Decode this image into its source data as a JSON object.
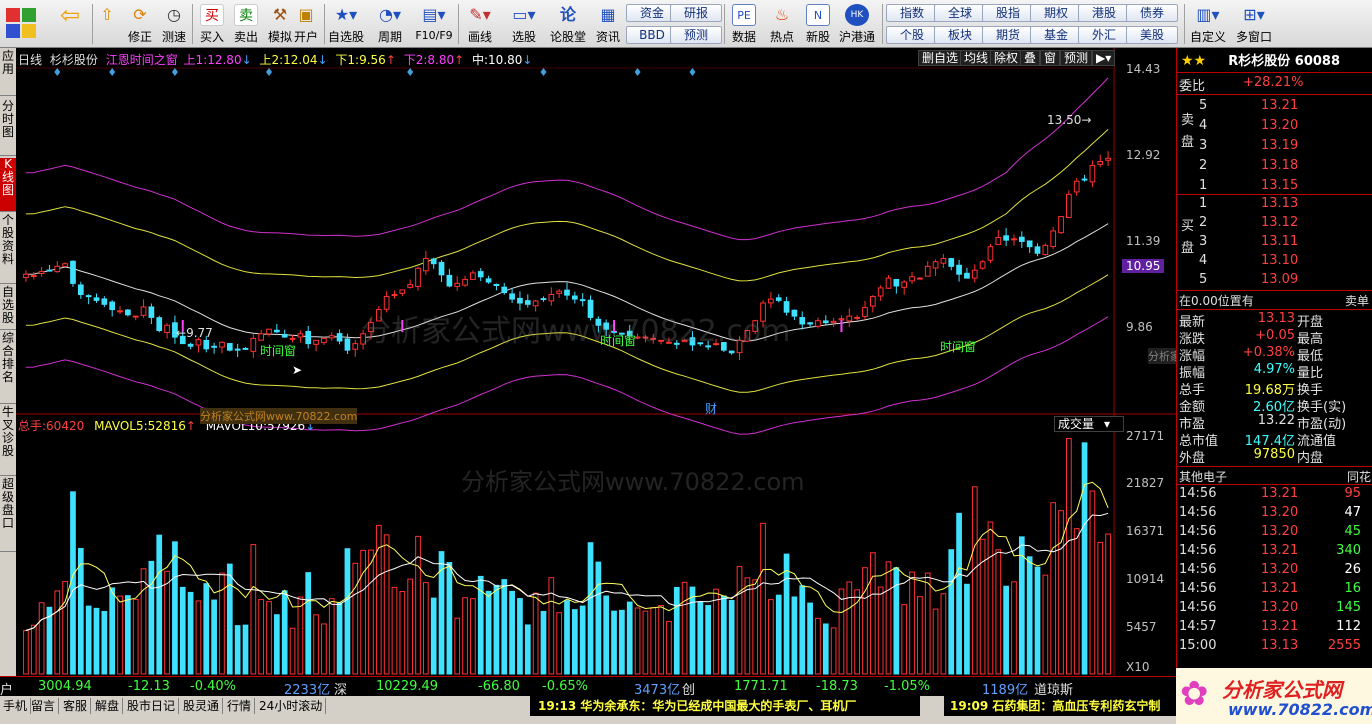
{
  "toolbar": {
    "buttons": [
      {
        "name": "back",
        "label": ""
      },
      {
        "name": "up",
        "label": ""
      },
      {
        "name": "fix",
        "label": "修正"
      },
      {
        "name": "measure",
        "label": "测速"
      },
      {
        "name": "buy",
        "label": "买入"
      },
      {
        "name": "sell",
        "label": "卖出"
      },
      {
        "name": "sim",
        "label": "模拟"
      },
      {
        "name": "open",
        "label": "开户"
      },
      {
        "name": "selfsel",
        "label": "自选股"
      },
      {
        "name": "period",
        "label": "周期"
      },
      {
        "name": "f10",
        "label": "F10/F9"
      },
      {
        "name": "draw",
        "label": "画线"
      },
      {
        "name": "pick",
        "label": "选股"
      },
      {
        "name": "forum",
        "label": "论股堂"
      },
      {
        "name": "info",
        "label": "资讯"
      },
      {
        "name": "data",
        "label": "数据"
      },
      {
        "name": "hot",
        "label": "热点"
      },
      {
        "name": "newstock",
        "label": "新股"
      },
      {
        "name": "hk",
        "label": "沪港通"
      },
      {
        "name": "custom",
        "label": "自定义"
      },
      {
        "name": "multiwin",
        "label": "多窗口"
      }
    ],
    "buy_char": "买",
    "sell_char": "卖",
    "small_buttons": [
      "资金",
      "研报",
      "BBD",
      "预测",
      "指数",
      "全球",
      "股指",
      "期权",
      "港股",
      "债券",
      "个股",
      "板块",
      "期货",
      "基金",
      "外汇",
      "美股"
    ]
  },
  "side_tabs": [
    "应用",
    "分时图",
    "K线图",
    "个股资料",
    "自选股",
    "综合排名",
    "牛叉诊股",
    "超级盘口"
  ],
  "chart_header": {
    "period": "日线",
    "stock": "杉杉股份",
    "indicator": "江恩时间之窗",
    "up1_label": "上1:",
    "up1": "12.80",
    "up2_label": "上2:",
    "up2": "12.04",
    "dn1_label": "下1:",
    "dn1": "9.56",
    "dn2_label": "下2:",
    "dn2": "8.80",
    "mid_label": "中:",
    "mid": "10.80"
  },
  "chart_controls": [
    "删自选",
    "均线",
    "除权",
    "叠",
    "窗",
    "预测"
  ],
  "price_axis": [
    "14.43",
    "12.92",
    "11.39",
    "10.95",
    "9.86"
  ],
  "volume_axis": [
    "27171",
    "21827",
    "16371",
    "10914",
    "5457",
    "X10"
  ],
  "annotations": {
    "high": "13.50",
    "low": "9.77",
    "time_window": "时间窗",
    "cai": "财",
    "watermark": "分析家公式网www.70822.com",
    "watermark_short": "分析家公式网www.70822.com"
  },
  "volume_header": {
    "total_label": "总手:",
    "total": "60420",
    "ma5_label": "MAVOL5:",
    "ma5": "52816",
    "ma10_label": "MAVOL10:",
    "ma10": "57926",
    "selector": "成交量"
  },
  "chart_data": {
    "type": "candlestick",
    "price_range": [
      9.5,
      14.6
    ],
    "volume_range": [
      0,
      28500
    ],
    "closes": [
      11.36,
      11.34,
      11.4,
      11.42,
      11.48,
      11.52,
      11.22,
      11.05,
      11.02,
      10.96,
      10.9,
      10.82,
      10.8,
      10.74,
      10.72,
      10.86,
      10.7,
      10.5,
      10.58,
      10.4,
      10.3,
      10.26,
      10.36,
      10.22,
      10.25,
      10.32,
      10.2,
      10.2,
      10.22,
      10.38,
      10.45,
      10.52,
      10.48,
      10.4,
      10.38,
      10.45,
      10.3,
      10.35,
      10.38,
      10.42,
      10.34,
      10.2,
      10.3,
      10.45,
      10.62,
      10.82,
      11.02,
      11.05,
      11.12,
      11.2,
      11.45,
      11.6,
      11.52,
      11.35,
      11.18,
      11.22,
      11.28,
      11.38,
      11.32,
      11.24,
      11.2,
      11.08,
      10.98,
      10.92,
      10.9,
      10.95,
      10.98,
      11.05,
      11.1,
      11.04,
      10.98,
      10.96,
      10.7,
      10.58,
      10.52,
      10.48,
      10.45,
      10.42,
      10.4,
      10.4,
      10.38,
      10.35,
      10.32,
      10.3,
      10.35,
      10.28,
      10.3,
      10.25,
      10.3,
      10.2,
      10.16,
      10.35,
      10.5,
      10.65,
      10.92,
      10.98,
      10.96,
      10.78,
      10.72,
      10.6,
      10.6,
      10.65,
      10.62,
      10.64,
      10.68,
      10.72,
      10.7,
      10.85,
      11.02,
      11.15,
      11.3,
      11.18,
      11.24,
      11.32,
      11.3,
      11.48,
      11.55,
      11.6,
      11.48,
      11.36,
      11.3,
      11.42,
      11.55,
      11.78,
      11.92,
      11.88,
      11.9,
      11.86,
      11.78,
      11.68,
      11.8,
      12.02,
      12.24,
      12.58,
      12.78,
      12.8,
      13.02,
      13.08,
      13.13
    ]
  },
  "quote": {
    "title": "R杉杉股份 60088",
    "weibi_label": "委比",
    "weibi": "+28.21%",
    "sell_label": "卖盘",
    "buy_label": "买盘",
    "sells": [
      {
        "lv": "5",
        "p": "13.21"
      },
      {
        "lv": "4",
        "p": "13.20"
      },
      {
        "lv": "3",
        "p": "13.19"
      },
      {
        "lv": "2",
        "p": "13.18"
      },
      {
        "lv": "1",
        "p": "13.15"
      }
    ],
    "buys": [
      {
        "lv": "1",
        "p": "13.13"
      },
      {
        "lv": "2",
        "p": "13.12"
      },
      {
        "lv": "3",
        "p": "13.11"
      },
      {
        "lv": "4",
        "p": "13.10"
      },
      {
        "lv": "5",
        "p": "13.09"
      }
    ],
    "pos_label": "在0.00位置有",
    "pos_right": "卖单",
    "stats": [
      {
        "k": "最新",
        "v": "13.13",
        "k2": "开盘",
        "c": "red"
      },
      {
        "k": "涨跌",
        "v": "+0.05",
        "k2": "最高",
        "c": "red"
      },
      {
        "k": "涨幅",
        "v": "+0.38%",
        "k2": "最低",
        "c": "red"
      },
      {
        "k": "振幅",
        "v": "4.97%",
        "k2": "量比",
        "c": "cyan"
      },
      {
        "k": "总手",
        "v": "19.68万",
        "k2": "换手",
        "c": "yellow"
      },
      {
        "k": "金额",
        "v": "2.60亿",
        "k2": "换手(实)",
        "c": "cyan"
      },
      {
        "k": "市盈",
        "v": "13.22",
        "k2": "市盈(动)",
        "c": "white"
      },
      {
        "k": "总市值",
        "v": "147.4亿",
        "k2": "流通值",
        "c": "cyan"
      },
      {
        "k": "外盘",
        "v": "97850",
        "k2": "内盘",
        "c": "yellow"
      }
    ],
    "sector": "其他电子",
    "sector_right": "同花",
    "ticks": [
      {
        "t": "14:56",
        "p": "13.21",
        "v": "95"
      },
      {
        "t": "14:56",
        "p": "13.20",
        "v": "47"
      },
      {
        "t": "14:56",
        "p": "13.20",
        "v": "45"
      },
      {
        "t": "14:56",
        "p": "13.21",
        "v": "340"
      },
      {
        "t": "14:56",
        "p": "13.20",
        "v": "26"
      },
      {
        "t": "14:56",
        "p": "13.21",
        "v": "16"
      },
      {
        "t": "14:56",
        "p": "13.20",
        "v": "145"
      },
      {
        "t": "14:57",
        "p": "13.21",
        "v": "112"
      },
      {
        "t": "15:00",
        "p": "13.13",
        "v": "2555"
      }
    ]
  },
  "index_bar": {
    "sh": {
      "v": "3004.94",
      "chg": "-12.13",
      "pct": "-0.40%",
      "amt": "2233亿"
    },
    "sz_label": "深",
    "sz": {
      "v": "10229.49",
      "chg": "-66.80",
      "pct": "-0.65%",
      "amt": "3473亿"
    },
    "cy_label": "创",
    "cy": {
      "v": "1771.71",
      "chg": "-18.73",
      "pct": "-1.05%",
      "amt": "1189亿"
    },
    "dj_label": "道琼斯",
    "left": "户"
  },
  "status_bar": {
    "tabs": [
      "手机",
      "留言",
      "客服",
      "解盘",
      "股市日记",
      "股灵通",
      "行情",
      "24小时滚动"
    ],
    "news1": "19:13 华为余承东：华为已经成中国最大的手表厂、耳机厂",
    "news2": "19:09 石药集团：高血压专利药玄宁制",
    "logo": "分析家公式网",
    "logo_url": "www.70822.com"
  }
}
